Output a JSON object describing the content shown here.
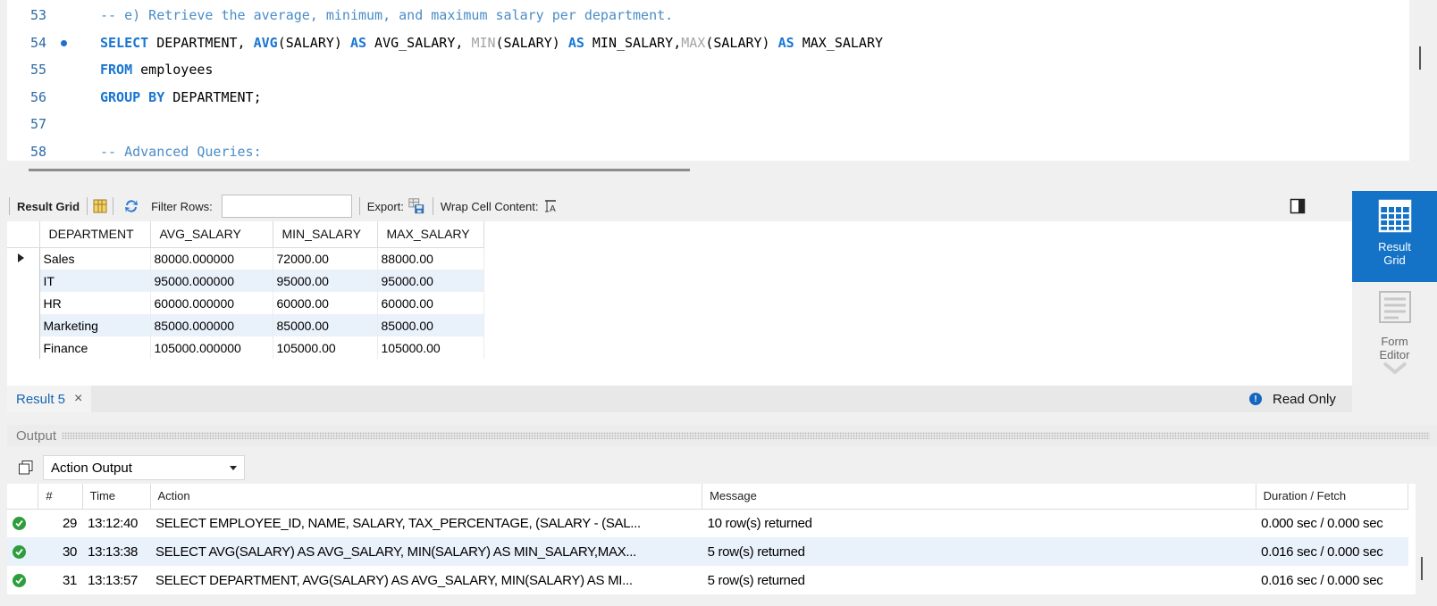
{
  "editor": {
    "lines": [
      {
        "num": "53",
        "tokens": [
          {
            "t": "-- e) Retrieve the average, minimum, and maximum salary per department.",
            "c": "cm"
          }
        ]
      },
      {
        "num": "54",
        "breakpoint": true,
        "tokens": [
          {
            "t": "SELECT",
            "c": "kw"
          },
          {
            "t": " DEPARTMENT, ",
            "c": ""
          },
          {
            "t": "AVG",
            "c": "kw"
          },
          {
            "t": "(SALARY) ",
            "c": ""
          },
          {
            "t": "AS",
            "c": "kw"
          },
          {
            "t": " AVG_SALARY, ",
            "c": ""
          },
          {
            "t": "MIN",
            "c": "fn"
          },
          {
            "t": "(SALARY) ",
            "c": ""
          },
          {
            "t": "AS",
            "c": "kw"
          },
          {
            "t": " MIN_SALARY,",
            "c": ""
          },
          {
            "t": "MAX",
            "c": "fn"
          },
          {
            "t": "(SALARY) ",
            "c": ""
          },
          {
            "t": "AS",
            "c": "kw"
          },
          {
            "t": " MAX_SALARY",
            "c": ""
          }
        ]
      },
      {
        "num": "55",
        "tokens": [
          {
            "t": "FROM",
            "c": "kw"
          },
          {
            "t": " employees",
            "c": ""
          }
        ]
      },
      {
        "num": "56",
        "tokens": [
          {
            "t": "GROUP BY",
            "c": "kw"
          },
          {
            "t": " DEPARTMENT;",
            "c": ""
          }
        ]
      },
      {
        "num": "57",
        "tokens": []
      },
      {
        "num": "58",
        "tokens": [
          {
            "t": "-- Advanced Queries:",
            "c": "cm"
          }
        ]
      }
    ]
  },
  "result_toolbar": {
    "result_grid_label": "Result Grid",
    "filter_rows_label": "Filter Rows:",
    "filter_value": "",
    "export_label": "Export:",
    "wrap_label": "Wrap Cell Content:"
  },
  "result_grid": {
    "columns": [
      "DEPARTMENT",
      "AVG_SALARY",
      "MIN_SALARY",
      "MAX_SALARY"
    ],
    "rows": [
      [
        "Sales",
        "80000.000000",
        "72000.00",
        "88000.00"
      ],
      [
        "IT",
        "95000.000000",
        "95000.00",
        "95000.00"
      ],
      [
        "HR",
        "60000.000000",
        "60000.00",
        "60000.00"
      ],
      [
        "Marketing",
        "85000.000000",
        "85000.00",
        "85000.00"
      ],
      [
        "Finance",
        "105000.000000",
        "105000.00",
        "105000.00"
      ]
    ]
  },
  "side_panel": {
    "result_grid": "Result Grid",
    "form_editor": "Form Editor"
  },
  "tabbar": {
    "tab_label": "Result 5",
    "read_only": "Read Only"
  },
  "output": {
    "header": "Output",
    "selector": "Action Output",
    "columns": [
      "#",
      "Time",
      "Action",
      "Message",
      "Duration / Fetch"
    ],
    "rows": [
      {
        "num": "29",
        "time": "13:12:40",
        "action": "SELECT EMPLOYEE_ID, NAME, SALARY, TAX_PERCENTAGE, (SALARY - (SAL...",
        "message": "10 row(s) returned",
        "duration": "0.000 sec / 0.000 sec"
      },
      {
        "num": "30",
        "time": "13:13:38",
        "action": "SELECT AVG(SALARY) AS AVG_SALARY, MIN(SALARY) AS MIN_SALARY,MAX...",
        "message": "5 row(s) returned",
        "duration": "0.016 sec / 0.000 sec"
      },
      {
        "num": "31",
        "time": "13:13:57",
        "action": "SELECT DEPARTMENT, AVG(SALARY) AS AVG_SALARY, MIN(SALARY) AS MI...",
        "message": "5 row(s) returned",
        "duration": "0.016 sec / 0.000 sec"
      }
    ]
  }
}
